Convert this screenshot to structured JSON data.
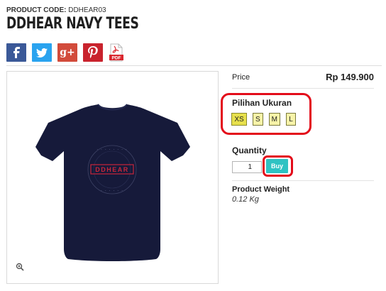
{
  "product": {
    "code_label": "PRODUCT CODE:",
    "code_value": "DDHEAR03",
    "title": "DDHEAR NAVY TEES",
    "shirt_print": "DDHEAR"
  },
  "share": {
    "facebook_icon": "facebook-icon",
    "twitter_icon": "twitter-icon",
    "googleplus_icon": "google-plus-icon",
    "googleplus_text": "g+",
    "pinterest_icon": "pinterest-icon",
    "pdf_icon": "pdf-icon",
    "pdf_text": "PDF"
  },
  "price": {
    "label": "Price",
    "value": "Rp 149.900"
  },
  "size": {
    "label": "Pilihan Ukuran",
    "options": [
      "XS",
      "S",
      "M",
      "L"
    ],
    "selected": "XS"
  },
  "quantity": {
    "label": "Quantity",
    "value": "1",
    "buy_label": "Buy"
  },
  "weight": {
    "label": "Product Weight",
    "value": "0.12 Kg"
  },
  "colors": {
    "shirt_navy": "#161a3a",
    "highlight_red": "#e30c1a",
    "buy_teal": "#2ec3c3",
    "size_yellow": "#f7f3a8"
  }
}
